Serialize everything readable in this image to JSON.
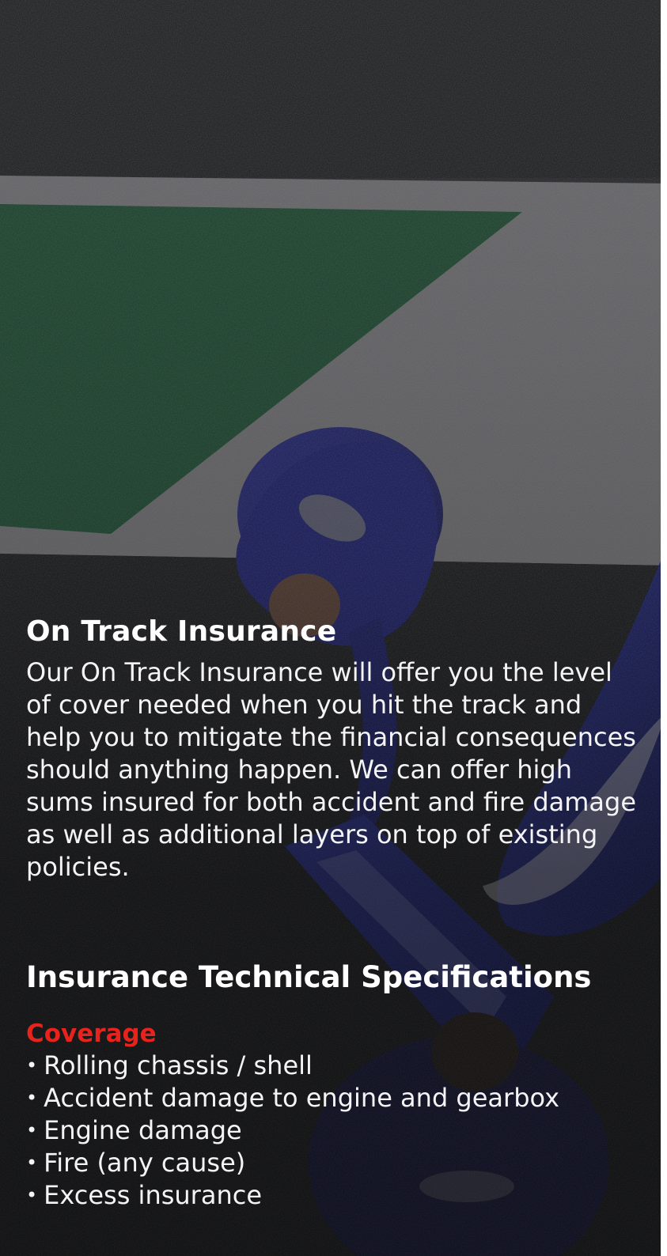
{
  "section": {
    "title": "On Track Insurance",
    "description": "Our On Track Insurance will offer you the level of cover needed when you hit the track and help you to mitigate the financial consequences should anything happen. We can offer high sums insured for both accident and fire damage as well as additional layers on top of existing policies."
  },
  "specs": {
    "title": "Insurance Technical Specifications",
    "coverage_label": "Coverage",
    "bullet_glyph": "•",
    "items": [
      "Rolling chassis / shell",
      "Accident damage to engine and gearbox",
      "Engine damage",
      "Fire (any cause)",
      "Excess insurance"
    ]
  },
  "colors": {
    "accent_red": "#e8231c",
    "text_white": "#ffffff"
  }
}
